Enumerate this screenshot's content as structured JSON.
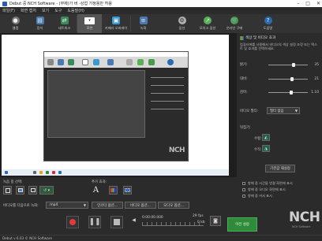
{
  "window": {
    "title": "Debut 중 NCH Software - (무제)가 버 -상업 가정용만 허용",
    "controls": [
      "–",
      "□",
      "✕"
    ]
  },
  "menu": [
    "파일(F)",
    "화면 캡처",
    "보기",
    "도구",
    "도움말(H)"
  ],
  "toolbar": [
    {
      "label": "웹캠",
      "icon": "webcam-icon",
      "color": "#7a7a7a"
    },
    {
      "label": "장치",
      "icon": "device-icon",
      "color": "#4a7ab0"
    },
    {
      "label": "네트워크",
      "icon": "network-icon",
      "color": "#3a8a5a"
    },
    {
      "label": "화면",
      "icon": "screen-icon",
      "color": "#ffffff"
    },
    {
      "label": "카메라 오버레이",
      "icon": "camera-overlay-icon",
      "color": "#3a9acb"
    },
    {
      "label": "녹화",
      "icon": "record-list-icon",
      "color": "#4a7ab0"
    },
    {
      "label": "옵션",
      "icon": "options-icon",
      "color": "#b0b0b0"
    },
    {
      "label": "모의고 옵션",
      "icon": "share-icon",
      "color": "#5ab05a"
    },
    {
      "label": "온라인 구매",
      "icon": "cart-icon",
      "color": "#4a9a4a"
    },
    {
      "label": "도움말",
      "icon": "help-icon",
      "color": "#2a6ab0"
    }
  ],
  "effects": {
    "title": "색상 및 비디오 효과",
    "description": "컴퓨터에를 사용해서 비디오의 색상 설정 조정 또는 텍스트 및 효과를 선택하세요.",
    "sliders": [
      {
        "label": "밝기:",
        "value": "35",
        "level": 0.62
      },
      {
        "label": "대비:",
        "value": "21",
        "level": 0.58
      },
      {
        "label": "감마:",
        "value": "1.10",
        "level": 0.55
      }
    ],
    "filter_label": "비디오 필터:",
    "filter_value": "필터 없음",
    "flip_label": "뒤집기:",
    "flip_h_label": "수평:",
    "flip_v_label": "수직:",
    "reset_label": "기본값 재설정",
    "checkboxes": [
      "항해 중 시간을 연결 화면에 표시",
      "항해 중 오디오 화면에 표시",
      "항해 중 커서 표시"
    ]
  },
  "bottom": {
    "record_label": "녹음 중 선택:",
    "add_label": "추가 효과:",
    "format_label": "비디오를 다음으로 녹화:",
    "format_value": ".mp4",
    "encoder_btn": "인코더 옵션...",
    "video_btn": "비디오 옵션...",
    "audio_btn": "오디오 옵션...",
    "time": "0:00:00.000",
    "fps": "29 fps",
    "size": "0 kb",
    "record_button": "이전 설정",
    "nch_logo": "NCH",
    "nch_sub": "NCH Software"
  },
  "status": "Debut v 6.03 © NCH Software"
}
